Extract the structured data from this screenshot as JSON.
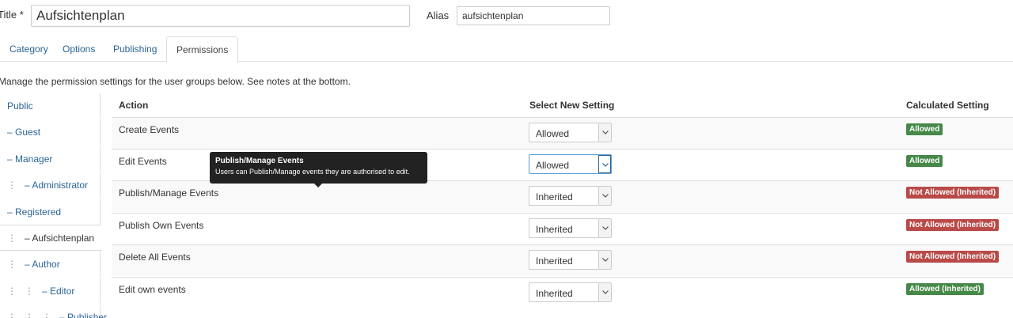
{
  "form": {
    "title_label": "Title *",
    "title_value": "Aufsichtenplan",
    "alias_label": "Alias",
    "alias_value": "aufsichtenplan"
  },
  "tabs": [
    {
      "label": "Category"
    },
    {
      "label": "Options"
    },
    {
      "label": "Publishing"
    },
    {
      "label": "Permissions"
    }
  ],
  "intro": "Manage the permission settings for the user groups below. See notes at the bottom.",
  "groups": [
    {
      "prefix": "",
      "label": "Public"
    },
    {
      "prefix": "– ",
      "label": "Guest"
    },
    {
      "prefix": "– ",
      "label": "Manager"
    },
    {
      "prefix": "– ",
      "label": "Administrator"
    },
    {
      "prefix": "– ",
      "label": "Registered"
    },
    {
      "prefix": "– ",
      "label": "Aufsichtenplan"
    },
    {
      "prefix": "– ",
      "label": "Author"
    },
    {
      "prefix": "– ",
      "label": "Editor"
    },
    {
      "prefix": "– ",
      "label": "Publisher"
    }
  ],
  "table": {
    "headers": {
      "action": "Action",
      "select": "Select New Setting",
      "calculated": "Calculated Setting"
    },
    "rows": [
      {
        "action": "Create Events",
        "setting": "Allowed",
        "calculated": "Allowed"
      },
      {
        "action": "Edit Events",
        "setting": "Allowed",
        "calculated": "Allowed"
      },
      {
        "action": "Publish/Manage Events",
        "setting": "Inherited",
        "calculated": "Not Allowed (Inherited)"
      },
      {
        "action": "Publish Own Events",
        "setting": "Inherited",
        "calculated": "Not Allowed (Inherited)"
      },
      {
        "action": "Delete All Events",
        "setting": "Inherited",
        "calculated": "Not Allowed (Inherited)"
      },
      {
        "action": "Edit own events",
        "setting": "Inherited",
        "calculated": "Allowed (Inherited)"
      }
    ]
  },
  "tooltip": {
    "title": "Publish/Manage Events",
    "body": "Users can Publish/Manage events they are authorised to edit."
  },
  "colors": {
    "allowed": "#468847",
    "not_allowed": "#b94a48",
    "link": "#2a6496"
  }
}
